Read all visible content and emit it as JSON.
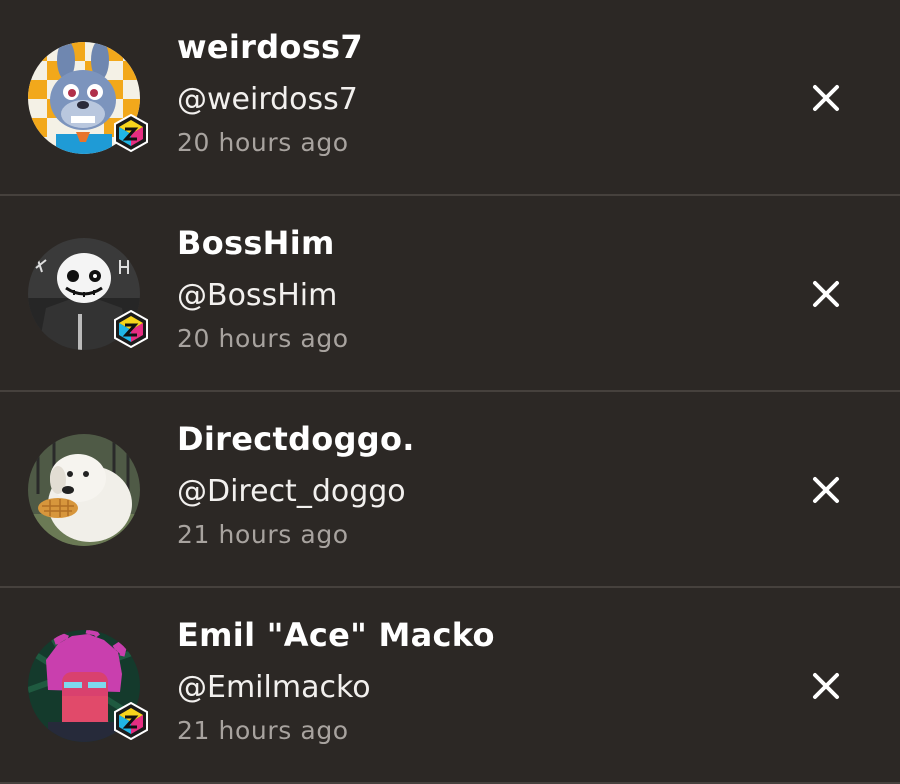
{
  "notifications": [
    {
      "name": "weirdoss7",
      "handle": "@weirdoss7",
      "time": "20 hours ago",
      "avatar_icon": "bunny-animatronic-avatar",
      "dismiss_icon": "close-icon"
    },
    {
      "name": "BossHim",
      "handle": "@BossHim",
      "time": "20 hours ago",
      "avatar_icon": "skeleton-hoodie-avatar",
      "dismiss_icon": "close-icon"
    },
    {
      "name": "Directdoggo.",
      "handle": "@Direct_doggo",
      "time": "21 hours ago",
      "avatar_icon": "white-dog-avatar",
      "dismiss_icon": "close-icon"
    },
    {
      "name": "Emil \"Ace\" Macko",
      "handle": "@Emilmacko",
      "time": "21 hours ago",
      "avatar_icon": "pink-hair-character-avatar",
      "dismiss_icon": "close-icon"
    }
  ],
  "colors": {
    "background": "#2c2825",
    "divider": "#46413d",
    "name_text": "#ffffff",
    "handle_text": "#f2f0ee",
    "time_text": "#a8a39f"
  }
}
